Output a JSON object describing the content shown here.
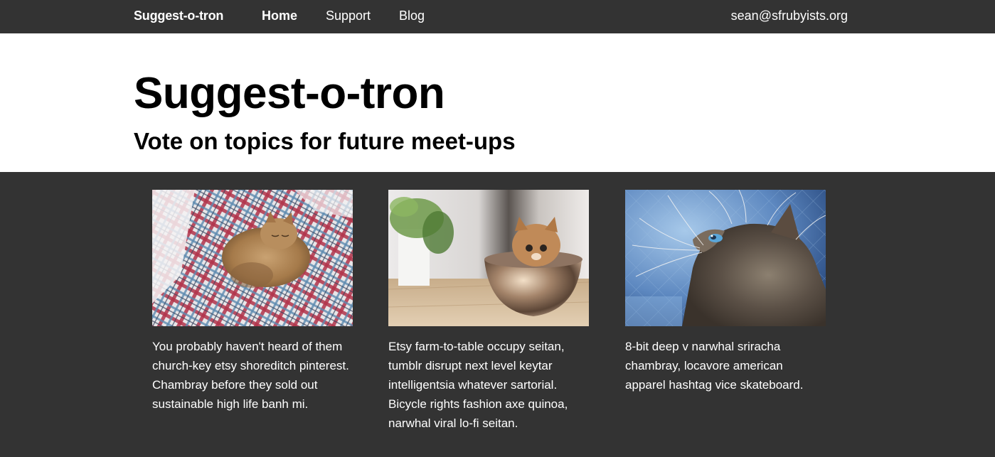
{
  "navbar": {
    "brand": "Suggest-o-tron",
    "links": [
      "Home",
      "Support",
      "Blog"
    ],
    "user_email": "sean@sfrubyists.org"
  },
  "hero": {
    "title": "Suggest-o-tron",
    "subtitle": "Vote on topics for future meet-ups"
  },
  "cards": [
    {
      "image": "kitten-in-plaid-shirt-photo",
      "text": "You probably haven't heard of them church-key etsy shoreditch pinterest. Chambray before they sold out sustainable high life banh mi."
    },
    {
      "image": "kitten-in-metal-bowl-photo",
      "text": "Etsy farm-to-table occupy seitan, tumblr disrupt next level keytar intelligentsia whatever sartorial. Bicycle rights fashion axe quinoa, narwhal viral lo-fi seitan."
    },
    {
      "image": "kitten-profile-blue-photo",
      "text": "8-bit deep v narwhal sriracha chambray, locavore american apparel hashtag vice skateboard."
    }
  ],
  "colors": {
    "navbar_bg": "#333333",
    "hero_bg": "#ffffff",
    "content_bg": "#333333",
    "text_light": "#ffffff",
    "text_dark": "#000000"
  }
}
